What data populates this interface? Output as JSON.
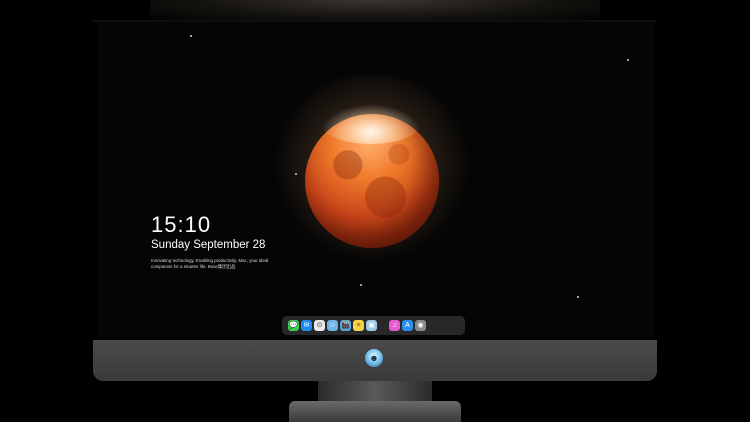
{
  "lock_screen": {
    "time": "15:10",
    "date": "Sunday September 28",
    "tagline": "Innovating technology, Enabling productivity, Mac, your ideal companion for a smarter life. Bose集团出品"
  },
  "dock": {
    "apps": [
      {
        "name": "messages",
        "glyph": "💬",
        "color": "#3ccf4e"
      },
      {
        "name": "mail",
        "glyph": "✉",
        "color": "#1d8cf0"
      },
      {
        "name": "safari",
        "glyph": "⊙",
        "color": "#e8e8e8"
      },
      {
        "name": "finder",
        "glyph": "☺",
        "color": "#6fb6e8"
      },
      {
        "name": "clips",
        "glyph": "🎬",
        "color": "#58a8e0"
      },
      {
        "name": "notes",
        "glyph": "≡",
        "color": "#f6d24a"
      },
      {
        "name": "photos",
        "glyph": "▣",
        "color": "#9ac8e8"
      },
      {
        "name": "music",
        "glyph": "♫",
        "color": "#e45ad0"
      },
      {
        "name": "app-store",
        "glyph": "A",
        "color": "#2a90f0"
      },
      {
        "name": "camera",
        "glyph": "◉",
        "color": "#8a8a8a"
      }
    ]
  },
  "monitor": {
    "logo_glyph": "☻"
  }
}
